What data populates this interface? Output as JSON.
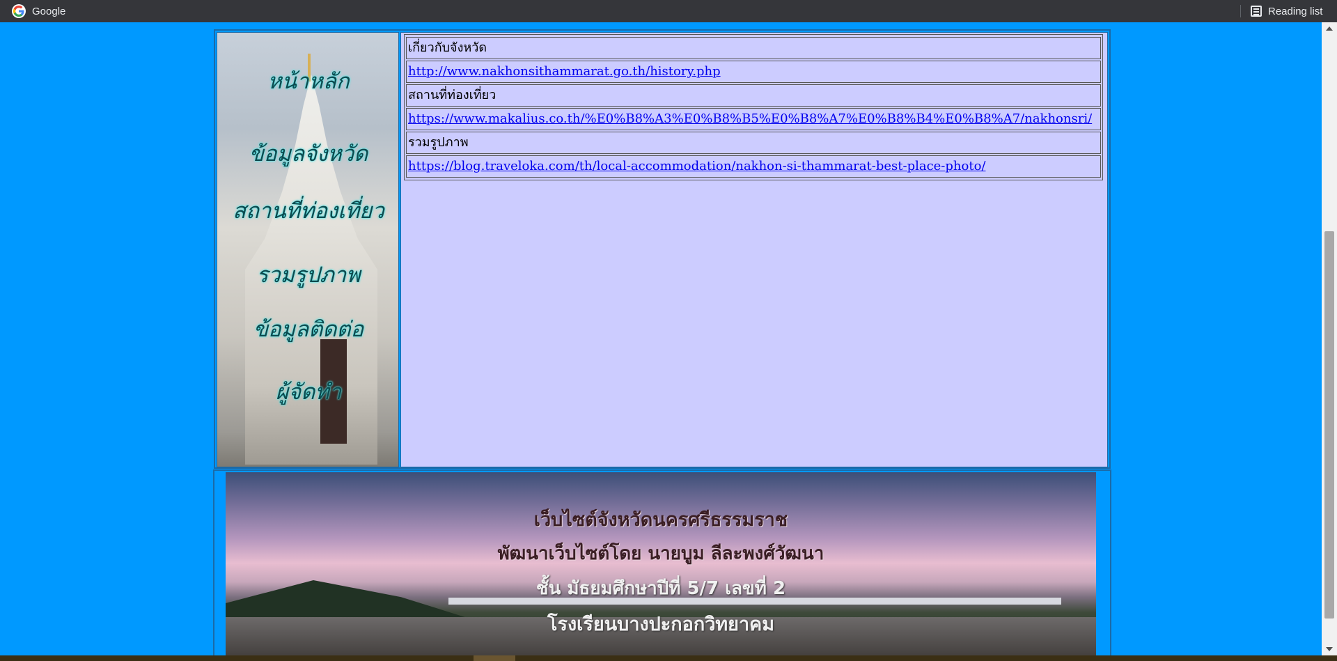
{
  "bookmarks_bar": {
    "google_label": "Google",
    "reading_list_label": "Reading list"
  },
  "menu": {
    "items": [
      "หน้าหลัก",
      "ข้อมูลจังหวัด",
      "สถานที่ท่องเที่ยว",
      "รวมรูปภาพ",
      "ข้อมูลติดต่อ",
      "ผู้จัดทำ"
    ]
  },
  "links_table": {
    "rows": [
      {
        "text": "เกี่ยวกับจังหวัด",
        "type": "heading"
      },
      {
        "text": "http://www.nakhonsithammarat.go.th/history.php",
        "type": "link"
      },
      {
        "text": "สถานที่ท่องเที่ยว",
        "type": "heading"
      },
      {
        "text": "https://www.makalius.co.th/%E0%B8%A3%E0%B8%B5%E0%B8%A7%E0%B8%B4%E0%B8%A7/nakhonsri/",
        "type": "link"
      },
      {
        "text": "รวมรูปภาพ",
        "type": "heading"
      },
      {
        "text": "https://blog.traveloka.com/th/local-accommodation/nakhon-si-thammarat-best-place-photo/",
        "type": "link"
      }
    ]
  },
  "banner": {
    "line1": "เว็บไซต์จังหวัดนครศรีธรรมราช",
    "line2": "พัฒนาเว็บไซต์โดย นายบูม ลีละพงศ์วัฒนา",
    "line3": "ชั้น มัธยมศึกษาปีที่ 5/7 เลขที่ 2",
    "line4": "โรงเรียนบางปะกอกวิทยาคม"
  },
  "colors": {
    "page_background": "#0099ff",
    "content_background": "#ccccff",
    "link_color": "#0000ee"
  }
}
